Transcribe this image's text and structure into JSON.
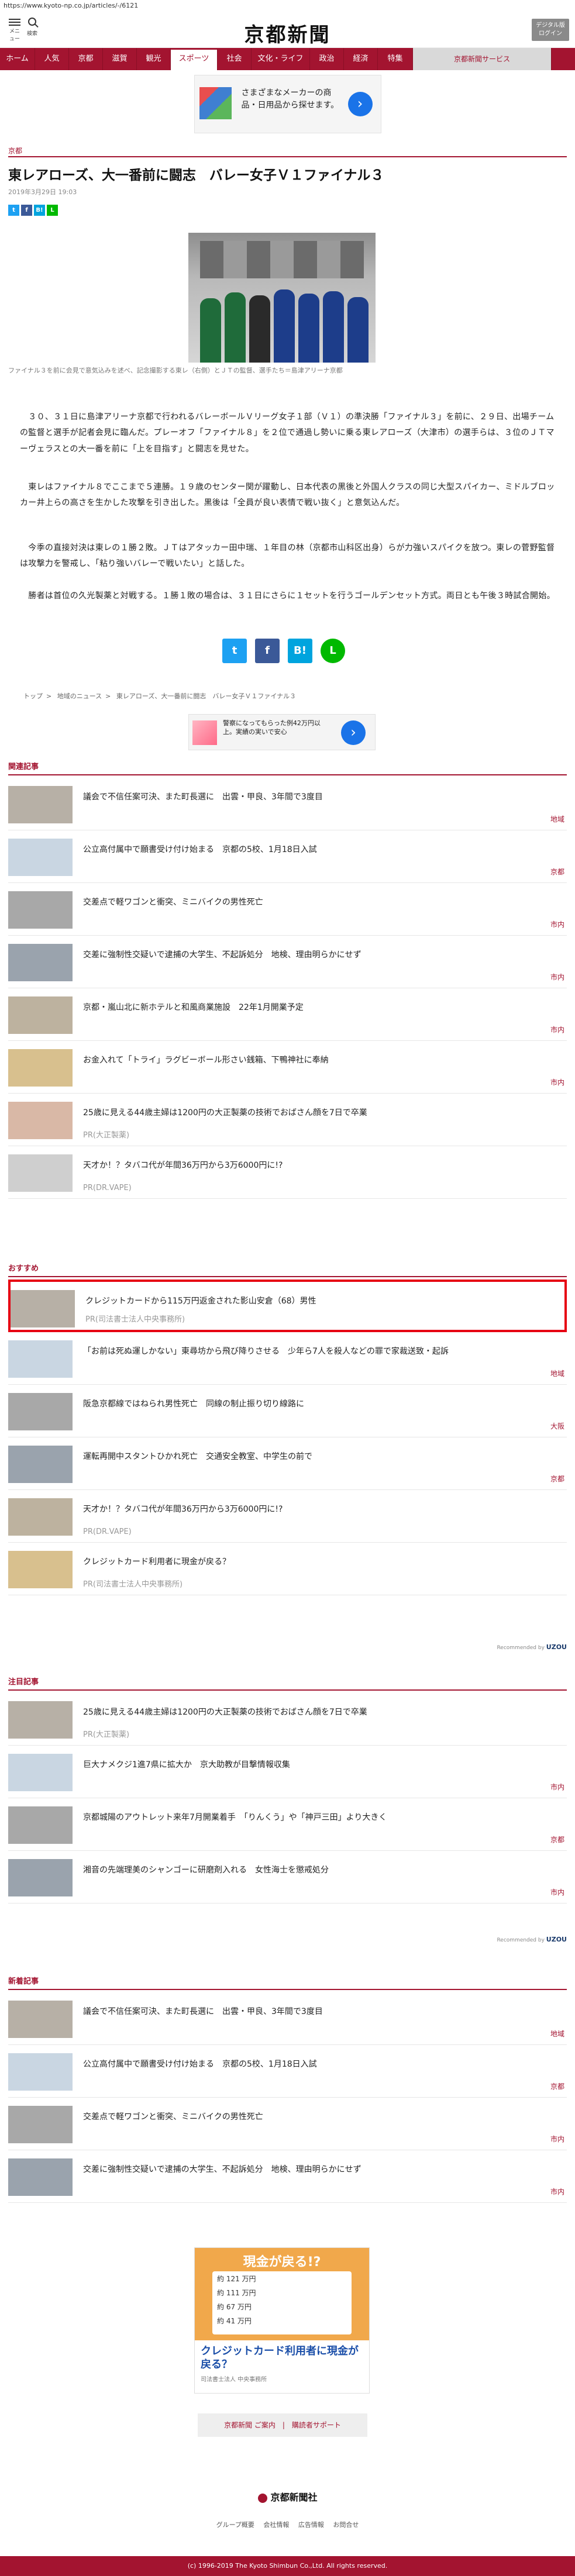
{
  "url": "https://www.kyoto-np.co.jp/articles/-/6121",
  "header": {
    "menu_label": "メニュー",
    "search_label": "検索",
    "logo": "京都新聞",
    "digital_btn": "デジタル版\nログイン"
  },
  "nav": [
    "ホーム",
    "人気",
    "京都",
    "滋賀",
    "観光",
    "スポーツ",
    "社会",
    "文化・ライフ",
    "政治",
    "経済",
    "特集",
    "京都新聞サービス"
  ],
  "ad_top": {
    "text": "さまざまなメーカーの商品・日用品から探せます。"
  },
  "article": {
    "category": "京都",
    "title": "東レアローズ、大一番前に闘志　バレー女子Ｖ１ファイナル３",
    "date": "2019年3月29日 19:03",
    "caption": "ファイナル３を前に会見で意気込みを述べ、記念撮影する東レ（右側）とＪＴの監督、選手たち＝島津アリーナ京都",
    "paragraphs": [
      "　３０、３１日に島津アリーナ京都で行われるバレーボールＶリーグ女子１部（Ｖ１）の準決勝「ファイナル３」を前に、２９日、出場チームの監督と選手が記者会見に臨んだ。プレーオフ「ファイナル８」を２位で通過し勢いに乗る東レアローズ（大津市）の選手らは、３位のＪＴマーヴェラスとの大一番を前に「上を目指す」と闘志を見せた。",
      "　東レはファイナル８でここまで５連勝。１９歳のセンター関が躍動し、日本代表の黒後と外国人クラスの同じ大型スパイカー、ミドルブロッカー井上らの高さを生かした攻撃を引き出した。黒後は「全員が良い表情で戦い抜く」と意気込んだ。",
      "　今季の直接対決は東レの１勝２敗。ＪＴはアタッカー田中瑞、１年目の林（京都市山科区出身）らが力強いスパイクを放つ。東レの菅野監督は攻撃力を警戒し、「粘り強いバレーで戦いたい」と話した。",
      "　勝者は首位の久光製薬と対戦する。１勝１敗の場合は、３１日にさらに１セットを行うゴールデンセット方式。両日とも午後３時試合開始。"
    ]
  },
  "share_small": [
    "t",
    "f",
    "B!",
    "L"
  ],
  "share_big": [
    "t",
    "f",
    "B!",
    "L"
  ],
  "breadcrumb": [
    "トップ",
    "地域のニュース",
    "東レアローズ、大一番前に闘志　バレー女子Ｖ１ファイナル３"
  ],
  "ad_small": {
    "text": "警察になってもらった例42万円以上。実績の実いで安心"
  },
  "related": {
    "heading": "関連記事",
    "items": [
      {
        "title": "議会で不信任案可決、また町長選に　出雲・甲良、3年間で3度目",
        "meta": "地域"
      },
      {
        "title": "公立高付属中で願書受け付け始まる　京都の5校、1月18日入試",
        "meta": "京都"
      },
      {
        "title": "交差点で軽ワゴンと衝突、ミニバイクの男性死亡",
        "meta": "市内"
      },
      {
        "title": "交差に強制性交疑いで逮捕の大学生、不起訴処分　地検、理由明らかにせず",
        "meta": "市内"
      },
      {
        "title": "京都・嵐山北に新ホテルと和風商業施設　22年1月開業予定",
        "meta": "市内"
      },
      {
        "title": "お金入れて「トライ」ラグビーボール形さい銭箱、下鴨神社に奉納",
        "meta": "市内"
      },
      {
        "title": "25歳に見える44歳主婦は1200円の大正製薬の技術でおばさん顔を7日で卒業",
        "pr": "PR(大正製薬)"
      },
      {
        "title": "天才か！？タバコ代が年間36万円から3万6000円に!?",
        "pr": "PR(DR.VAPE)"
      }
    ]
  },
  "osusume": {
    "heading": "おすすめ",
    "items": [
      {
        "title": "クレジットカードから115万円返金された影山安倉（68）男性",
        "pr": "PR(司法書士法人中央事務所)"
      },
      {
        "title": "「お前は死ぬ運しかない」東尋坊から飛び降りさせる　少年ら7人を殺人などの罪で家裁送致・起訴",
        "meta": "地域"
      },
      {
        "title": "阪急京都線ではねられ男性死亡　同線の制止振り切り線路に",
        "meta": "大阪"
      },
      {
        "title": "運転再開中スタントひかれ死亡　交通安全教室、中学生の前で",
        "meta": "京都"
      },
      {
        "title": "天才か！？タバコ代が年間36万円から3万6000円に!?",
        "pr": "PR(DR.VAPE)"
      },
      {
        "title": "クレジットカード利用者に現金が戻る？",
        "pr": "PR(司法書士法人中央事務所)"
      }
    ],
    "recommended_by": "Recommended by",
    "uzou": "UZOU"
  },
  "chumoku": {
    "heading": "注目記事",
    "items": [
      {
        "title": "25歳に見える44歳主婦は1200円の大正製薬の技術でおばさん顔を7日で卒業",
        "pr": "PR(大正製薬)"
      },
      {
        "title": "巨大ナメクジ1進7県に拡大か　京大助教が目撃情報収集",
        "meta": "市内"
      },
      {
        "title": "京都城陽のアウトレット来年7月開業着手　「りんくう」や「神戸三田」より大きく",
        "meta": "京都"
      },
      {
        "title": "湘音の先端理美のシャンゴーに研磨剤入れる　女性海士を懲戒処分",
        "meta": "市内"
      }
    ],
    "recommended_by": "Recommended by",
    "uzou": "UZOU"
  },
  "shinchaku": {
    "heading": "新着記事",
    "items": [
      {
        "title": "議会で不信任案可決、また町長選に　出雲・甲良、3年間で3度目",
        "meta": "地域"
      },
      {
        "title": "公立高付属中で願書受け付け始まる　京都の5校、1月18日入試",
        "meta": "京都"
      },
      {
        "title": "交差点で軽ワゴンと衝突、ミニバイクの男性死亡",
        "meta": "市内"
      },
      {
        "title": "交差に強制性交疑いで逮捕の大学生、不起訴処分　地検、理由明らかにせず",
        "meta": "市内"
      }
    ]
  },
  "ad_bottom": {
    "banner": "現金が戻る!?",
    "rows": [
      "約 121 万円",
      "約 111 万円",
      "約 67 万円",
      "約 41 万円"
    ],
    "caption": "クレジットカード利用者に現金が戻る？",
    "source": "司法書士法人 中央事務所"
  },
  "footer": {
    "links_box": "京都新聞 ご案内　|　購読者サポート",
    "logo": "京都新聞社",
    "nav": [
      "グループ概要",
      "会社情報",
      "広告情報",
      "お問合せ"
    ],
    "copyright": "(c) 1996-2019 The Kyoto Shimbun Co.,Ltd. All rights reserved."
  }
}
